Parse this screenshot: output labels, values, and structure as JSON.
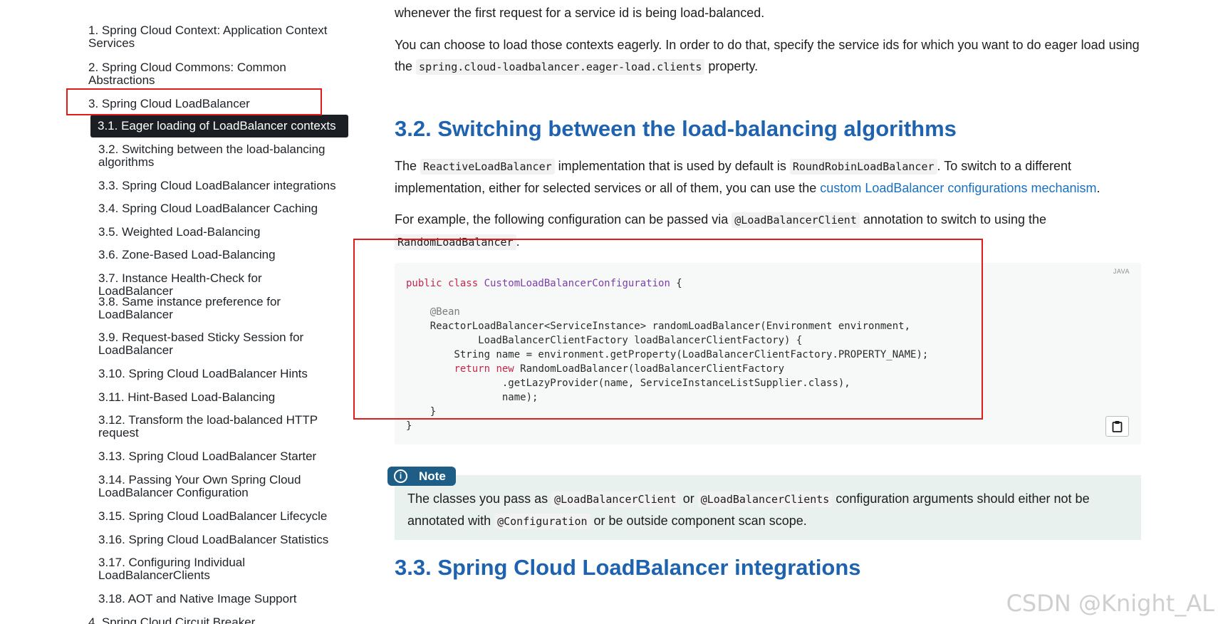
{
  "toc": {
    "items": [
      {
        "label": "1. Spring Cloud Context: Application Context Services"
      },
      {
        "label": "2. Spring Cloud Commons: Common Abstractions"
      },
      {
        "label": "3. Spring Cloud LoadBalancer"
      },
      {
        "label": "3.1. Eager loading of LoadBalancer contexts"
      },
      {
        "label": "3.2. Switching between the load-balancing algorithms"
      },
      {
        "label": "3.3. Spring Cloud LoadBalancer integrations"
      },
      {
        "label": "3.4. Spring Cloud LoadBalancer Caching"
      },
      {
        "label": "3.5. Weighted Load-Balancing"
      },
      {
        "label": "3.6. Zone-Based Load-Balancing"
      },
      {
        "label": "3.7. Instance Health-Check for LoadBalancer"
      },
      {
        "label": "3.8. Same instance preference for LoadBalancer"
      },
      {
        "label": "3.9. Request-based Sticky Session for LoadBalancer"
      },
      {
        "label": "3.10. Spring Cloud LoadBalancer Hints"
      },
      {
        "label": "3.11. Hint-Based Load-Balancing"
      },
      {
        "label": "3.12. Transform the load-balanced HTTP request"
      },
      {
        "label": "3.13. Spring Cloud LoadBalancer Starter"
      },
      {
        "label": "3.14. Passing Your Own Spring Cloud LoadBalancer Configuration"
      },
      {
        "label": "3.15. Spring Cloud LoadBalancer Lifecycle"
      },
      {
        "label": "3.16. Spring Cloud LoadBalancer Statistics"
      },
      {
        "label": "3.17. Configuring Individual LoadBalancerClients"
      },
      {
        "label": "3.18. AOT and Native Image Support"
      },
      {
        "label": "4. Spring Cloud Circuit Breaker"
      }
    ]
  },
  "content": {
    "p_intro": "whenever the first request for a service id is being load-balanced.",
    "p_eager_1": "You can choose to load those contexts eagerly. In order to do that, specify the service ids for which you want to do eager load using the",
    "p_eager_code": "spring.cloud-loadbalancer.eager-load.clients",
    "p_eager_2": " property.",
    "h2_switch": "3.2. Switching between the load-balancing algorithms",
    "p_switch_1": "The ",
    "p_switch_code1": "ReactiveLoadBalancer",
    "p_switch_2": " implementation that is used by default is ",
    "p_switch_code2": "RoundRobinLoadBalancer",
    "p_switch_3": ". To switch to a different implementation, either for selected services or all of them, you can use the ",
    "p_switch_link": "custom LoadBalancer configurations mechanism",
    "p_switch_4": ".",
    "p_example_1": "For example, the following configuration can be passed via ",
    "p_example_code1": "@LoadBalancerClient",
    "p_example_2": " annotation to switch to using the ",
    "p_example_code2": "RandomLoadBalancer",
    "p_example_3": ":",
    "code_lang": "JAVA",
    "note_label": "Note",
    "note_1": "The classes you pass as ",
    "note_code1": "@LoadBalancerClient",
    "note_2": " or ",
    "note_code2": "@LoadBalancerClients",
    "note_3": " configuration arguments should either not be annotated with ",
    "note_code3": "@Configuration",
    "note_4": " or be outside component scan scope.",
    "h2_integrations": "3.3. Spring Cloud LoadBalancer integrations"
  },
  "code": {
    "l1_kw": "public class ",
    "l1_type": "CustomLoadBalancerConfiguration",
    "l1_rest": " {",
    "l3": "    @Bean",
    "l4": "    ReactorLoadBalancer<ServiceInstance> randomLoadBalancer(Environment environment,",
    "l5": "            LoadBalancerClientFactory loadBalancerClientFactory) {",
    "l6": "        String name = environment.getProperty(LoadBalancerClientFactory.PROPERTY_NAME);",
    "l7_kw": "return new",
    "l7_rest": " RandomLoadBalancer(loadBalancerClientFactory",
    "l8": "                .getLazyProvider(name, ServiceInstanceListSupplier.class),",
    "l9": "                name);",
    "l10": "    }",
    "l11": "}"
  },
  "watermark": "CSDN @Knight_AL",
  "colors": {
    "heading": "#1f63b0",
    "link": "#1a6fc0",
    "highlight_box": "#e21b1b",
    "active_toc_bg": "#1b1f23",
    "note_badge": "#1e5e86",
    "note_bg": "#e8f1ee",
    "code_keyword": "#c0294b",
    "code_type": "#7a3fa8"
  }
}
